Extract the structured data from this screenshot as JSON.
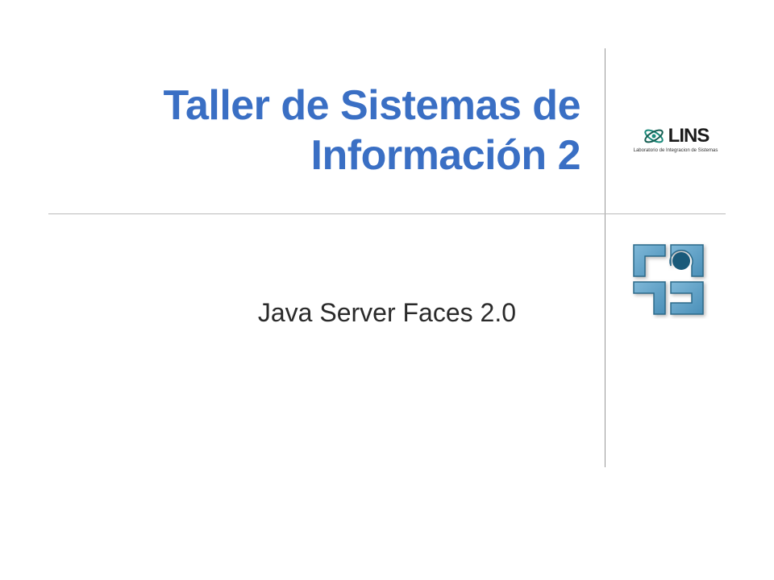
{
  "slide": {
    "title": "Taller de Sistemas de Información 2",
    "subtitle": "Java Server Faces  2.0",
    "logo": {
      "name": "LINS",
      "tagline": "Laboratorio de Integracion de Sistemas"
    }
  },
  "colors": {
    "title_color": "#3a6fc4",
    "subtitle_color": "#2a2a2a",
    "line_color": "#999999"
  }
}
